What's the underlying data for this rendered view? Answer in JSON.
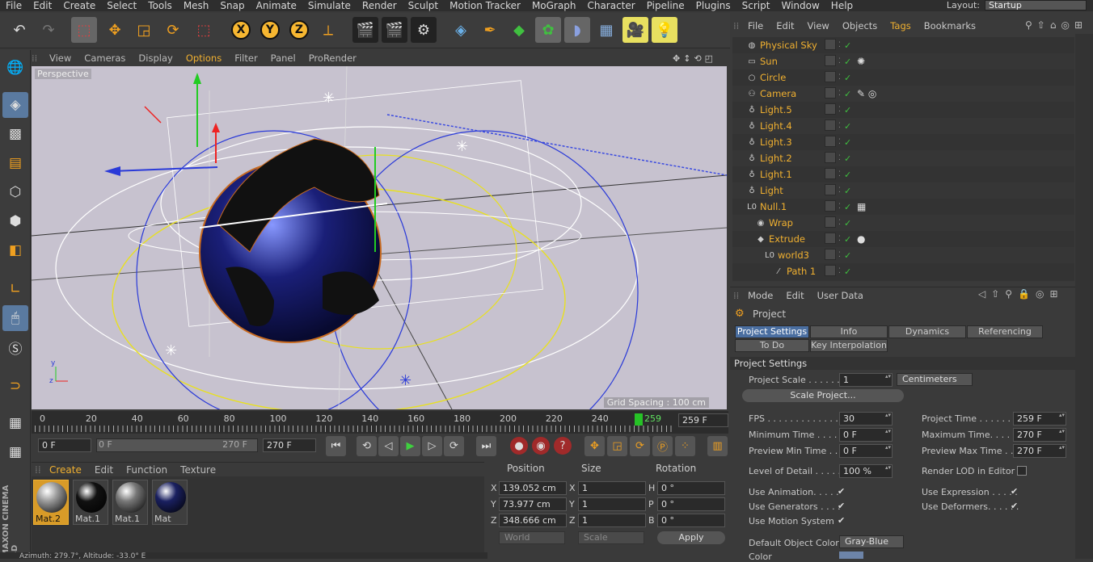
{
  "menu": [
    "File",
    "Edit",
    "Create",
    "Select",
    "Tools",
    "Mesh",
    "Snap",
    "Animate",
    "Simulate",
    "Render",
    "Sculpt",
    "Motion Tracker",
    "MoGraph",
    "Character",
    "Pipeline",
    "Plugins",
    "Script",
    "Window",
    "Help"
  ],
  "layout": {
    "label": "Layout:",
    "value": "Startup"
  },
  "viewport": {
    "menu": [
      "View",
      "Cameras",
      "Display",
      "Options",
      "Filter",
      "Panel",
      "ProRender"
    ],
    "active_menu": "Options",
    "label": "Perspective",
    "grid_spacing": "Grid Spacing : 100 cm"
  },
  "timeline": {
    "ticks": [
      "0",
      "20",
      "40",
      "60",
      "80",
      "100",
      "120",
      "140",
      "160",
      "180",
      "200",
      "220",
      "240"
    ],
    "current": "259",
    "end_field": "259 F"
  },
  "playbar": {
    "start": "0 F",
    "range_start": "0 F",
    "range_end": "270 F",
    "end": "270 F"
  },
  "materials": {
    "menu": [
      "Create",
      "Edit",
      "Function",
      "Texture"
    ],
    "items": [
      {
        "name": "Mat.2",
        "color": "#9a9a9a"
      },
      {
        "name": "Mat.1",
        "color": "#111111"
      },
      {
        "name": "Mat.1",
        "color": "#777777"
      },
      {
        "name": "Mat",
        "color": "#1a2060"
      }
    ]
  },
  "coords": {
    "headers": [
      "Position",
      "Size",
      "Rotation"
    ],
    "rows": [
      {
        "axis": "X",
        "pos": "139.052 cm",
        "saxis": "X",
        "size": "1",
        "raxis": "H",
        "rot": "0 °"
      },
      {
        "axis": "Y",
        "pos": "73.977 cm",
        "saxis": "Y",
        "size": "1",
        "raxis": "P",
        "rot": "0 °"
      },
      {
        "axis": "Z",
        "pos": "348.666 cm",
        "saxis": "Z",
        "size": "1",
        "raxis": "B",
        "rot": "0 °"
      }
    ],
    "world": "World",
    "scale": "Scale",
    "apply": "Apply"
  },
  "status": "Azimuth: 279.7°, Altitude: -33.0°  E",
  "objects": {
    "menu": [
      "File",
      "Edit",
      "View",
      "Objects",
      "Tags",
      "Bookmarks"
    ],
    "active_menu": "Tags",
    "rows": [
      {
        "name": "Physical Sky",
        "indent": 0,
        "icon": "◍",
        "tag": ""
      },
      {
        "name": "Sun",
        "indent": 0,
        "icon": "▭",
        "tag": "✺"
      },
      {
        "name": "Circle",
        "indent": 0,
        "icon": "○",
        "tag": ""
      },
      {
        "name": "Camera",
        "indent": 0,
        "icon": "⚇",
        "tag": "✎ ◎"
      },
      {
        "name": "Light.5",
        "indent": 0,
        "icon": "♁",
        "tag": ""
      },
      {
        "name": "Light.4",
        "indent": 0,
        "icon": "♁",
        "tag": ""
      },
      {
        "name": "Light.3",
        "indent": 0,
        "icon": "♁",
        "tag": ""
      },
      {
        "name": "Light.2",
        "indent": 0,
        "icon": "♁",
        "tag": ""
      },
      {
        "name": "Light.1",
        "indent": 0,
        "icon": "♁",
        "tag": ""
      },
      {
        "name": "Light",
        "indent": 0,
        "icon": "♁",
        "tag": ""
      },
      {
        "name": "Null.1",
        "indent": 0,
        "icon": "L0",
        "tag": "▦"
      },
      {
        "name": "Wrap",
        "indent": 1,
        "icon": "◉",
        "tag": ""
      },
      {
        "name": "Extrude",
        "indent": 1,
        "icon": "◆",
        "tag": "●"
      },
      {
        "name": "world3",
        "indent": 2,
        "icon": "L0",
        "tag": ""
      },
      {
        "name": "Path 1",
        "indent": 3,
        "icon": "⁄",
        "tag": ""
      }
    ]
  },
  "attributes": {
    "menu": [
      "Mode",
      "Edit",
      "User Data"
    ],
    "title": "Project",
    "tabs_row1": [
      "Project Settings",
      "Info",
      "Dynamics",
      "Referencing"
    ],
    "tabs_row2": [
      "To Do",
      "Key Interpolation"
    ],
    "section": "Project Settings",
    "project_scale_label": "Project Scale . . . . . .",
    "project_scale": "1",
    "units": "Centimeters",
    "scale_btn": "Scale Project...",
    "fields_left": [
      {
        "label": "FPS . . . . . . . . . . . . . .",
        "value": "30"
      },
      {
        "label": "Minimum Time . . . . . .",
        "value": "0 F"
      },
      {
        "label": "Preview Min Time . . .",
        "value": "0 F"
      }
    ],
    "fields_right": [
      {
        "label": "Project Time . . . . . . . .",
        "value": "259 F"
      },
      {
        "label": "Maximum Time. . . . . . .",
        "value": "270 F"
      },
      {
        "label": "Preview Max Time . . . .",
        "value": "270 F"
      }
    ],
    "lod_label": "Level of Detail . . . . .",
    "lod": "100 %",
    "render_lod": "Render LOD in Editor",
    "checks": [
      {
        "label": "Use Animation. . . . .",
        "checked": true
      },
      {
        "label": "Use Expression . . . . .",
        "checked": true
      },
      {
        "label": "Use Generators . . . .",
        "checked": true
      },
      {
        "label": "Use Deformers. . . . . .",
        "checked": true
      },
      {
        "label": "Use Motion System",
        "checked": true
      }
    ],
    "default_color_label": "Default Object Color",
    "default_color": "Gray-Blue",
    "color_label": "Color"
  }
}
